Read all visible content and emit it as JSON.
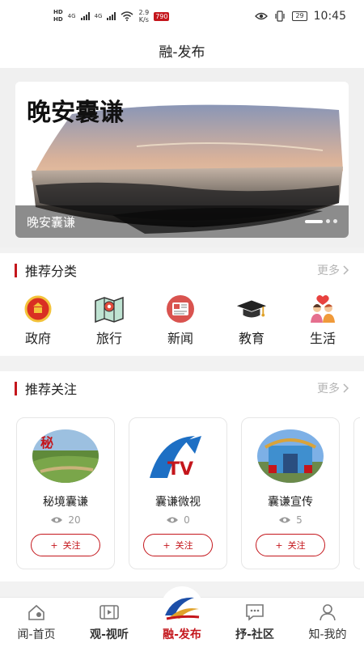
{
  "status": {
    "speed": "2.9",
    "speed_unit": "K/s",
    "net_a": "4G",
    "net_b": "4G",
    "hd_a": "HD",
    "hd_b": "HD",
    "badge": "790",
    "battery": "29",
    "time": "10:45"
  },
  "header": {
    "title": "融-发布"
  },
  "banner": {
    "image_title": "晚安囊谦",
    "caption": "晚安囊谦"
  },
  "categories": {
    "title": "推荐分类",
    "more": "更多",
    "items": [
      {
        "label": "政府",
        "icon": "emblem-icon"
      },
      {
        "label": "旅行",
        "icon": "map-icon"
      },
      {
        "label": "新闻",
        "icon": "newspaper-icon"
      },
      {
        "label": "教育",
        "icon": "graduation-cap-icon"
      },
      {
        "label": "生活",
        "icon": "family-icon"
      }
    ]
  },
  "follows": {
    "title": "推荐关注",
    "more": "更多",
    "follow_label": "关注",
    "items": [
      {
        "name": "秘境囊谦",
        "views": "20",
        "logo_text": "秘"
      },
      {
        "name": "囊谦微视",
        "views": "0",
        "logo_text": "TV"
      },
      {
        "name": "囊谦宣传",
        "views": "5",
        "logo_text": ""
      }
    ]
  },
  "tabs": [
    {
      "label": "闻-首页",
      "icon": "home-icon"
    },
    {
      "label": "观-视听",
      "icon": "film-icon"
    },
    {
      "label": "融-发布",
      "icon": "app-logo-icon"
    },
    {
      "label": "抒-社区",
      "icon": "chat-icon"
    },
    {
      "label": "知-我的",
      "icon": "user-icon"
    }
  ],
  "colors": {
    "accent": "#c4161c",
    "muted": "#b5b5b5"
  }
}
